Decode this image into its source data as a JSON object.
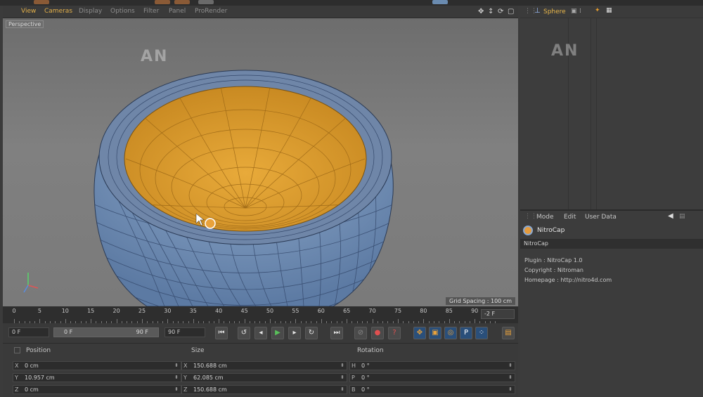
{
  "viewport": {
    "menu": [
      "View",
      "Cameras",
      "Display",
      "Options",
      "Filter",
      "Panel",
      "ProRender"
    ],
    "active_menu": "Cameras",
    "label": "Perspective",
    "grid_spacing": "Grid Spacing : 100 cm",
    "watermark": "AN"
  },
  "object_manager": {
    "object_name": "Sphere",
    "watermark": "AN"
  },
  "attribute_manager": {
    "menu": [
      "Mode",
      "Edit",
      "User Data"
    ],
    "object_title": "NitroCap",
    "tab": "NitroCap",
    "plugin": "Plugin : NitroCap 1.0",
    "copyright": "Copyright : Nitroman",
    "homepage": "Homepage : http://nitro4d.com"
  },
  "timeline": {
    "ticks": [
      "0",
      "5",
      "10",
      "15",
      "20",
      "25",
      "30",
      "35",
      "40",
      "45",
      "50",
      "55",
      "60",
      "65",
      "70",
      "75",
      "80",
      "85",
      "90"
    ],
    "current_frame": "-2 F"
  },
  "transport": {
    "start_frame": "0 F",
    "range_start": "0 F",
    "range_end": "90 F",
    "end_frame": "90 F"
  },
  "coordinates": {
    "headers": {
      "position": "Position",
      "size": "Size",
      "rotation": "Rotation"
    },
    "position": [
      {
        "axis": "X",
        "value": "0 cm"
      },
      {
        "axis": "Y",
        "value": "10.957 cm"
      },
      {
        "axis": "Z",
        "value": "0 cm"
      }
    ],
    "size": [
      {
        "axis": "X",
        "value": "150.688 cm"
      },
      {
        "axis": "Y",
        "value": "62.085 cm"
      },
      {
        "axis": "Z",
        "value": "150.688 cm"
      }
    ],
    "rotation": [
      {
        "axis": "H",
        "value": "0 °"
      },
      {
        "axis": "P",
        "value": "0 °"
      },
      {
        "axis": "B",
        "value": "0 °"
      }
    ]
  },
  "colors": {
    "accent_orange": "#e3a33a",
    "mesh_blue": "#7f9ec4",
    "wire": "#2e3d55"
  }
}
